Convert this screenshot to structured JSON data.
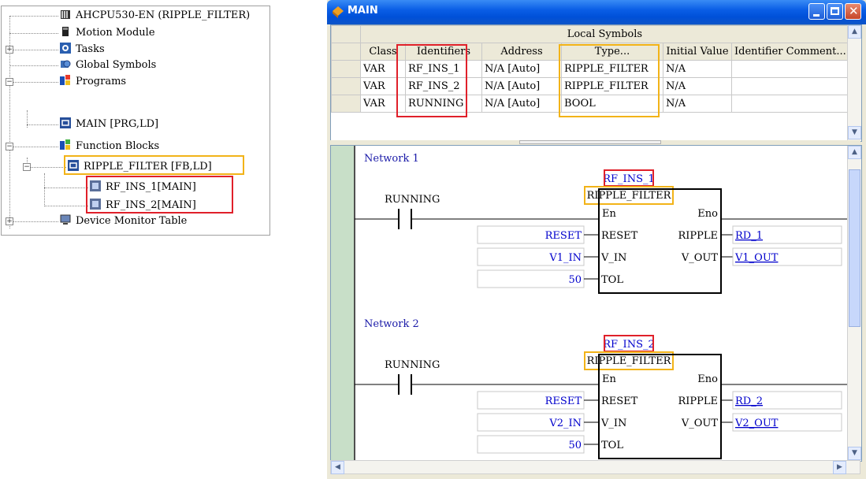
{
  "tree": {
    "items": [
      {
        "label": "AHCPU530-EN  (RIPPLE_FILTER)"
      },
      {
        "label": "Motion Module"
      },
      {
        "label": "Tasks"
      },
      {
        "label": "Global Symbols"
      },
      {
        "label": "Programs"
      },
      {
        "label": "MAIN [PRG,LD]"
      },
      {
        "label": "Function Blocks"
      },
      {
        "label": "RIPPLE_FILTER [FB,LD]"
      },
      {
        "label": "RF_INS_1[MAIN]"
      },
      {
        "label": "RF_INS_2[MAIN]"
      },
      {
        "label": "Device Monitor Table"
      }
    ]
  },
  "window": {
    "title": "MAIN",
    "local_symbols": {
      "caption": "Local Symbols",
      "columns": [
        "Class",
        "Identifiers",
        "Address",
        "Type...",
        "Initial Value",
        "Identifier Comment..."
      ],
      "rows": [
        [
          "VAR",
          "RF_INS_1",
          "N/A [Auto]",
          "RIPPLE_FILTER",
          "N/A",
          ""
        ],
        [
          "VAR",
          "RF_INS_2",
          "N/A [Auto]",
          "RIPPLE_FILTER",
          "N/A",
          ""
        ],
        [
          "VAR",
          "RUNNING",
          "N/A [Auto]",
          "BOOL",
          "N/A",
          ""
        ]
      ]
    }
  },
  "networks": [
    {
      "title": "Network 1",
      "contact": "RUNNING",
      "instance": "RF_INS_1",
      "fb_type": "RIPPLE_FILTER",
      "pin_en": "En",
      "pin_eno": "Eno",
      "inputs": [
        {
          "pin": "RESET",
          "var": "RESET"
        },
        {
          "pin": "V_IN",
          "var": "V1_IN"
        },
        {
          "pin": "TOL",
          "var": "50"
        }
      ],
      "outputs": [
        {
          "pin": "RIPPLE",
          "var": "RD_1"
        },
        {
          "pin": "V_OUT",
          "var": "V1_OUT"
        }
      ]
    },
    {
      "title": "Network 2",
      "contact": "RUNNING",
      "instance": "RF_INS_2",
      "fb_type": "RIPPLE_FILTER",
      "pin_en": "En",
      "pin_eno": "Eno",
      "inputs": [
        {
          "pin": "RESET",
          "var": "RESET"
        },
        {
          "pin": "V_IN",
          "var": "V2_IN"
        },
        {
          "pin": "TOL",
          "var": "50"
        }
      ],
      "outputs": [
        {
          "pin": "RIPPLE",
          "var": "RD_2"
        },
        {
          "pin": "V_OUT",
          "var": "V2_OUT"
        }
      ]
    }
  ],
  "colors": {
    "highlight_red": "#e0202a",
    "highlight_yellow": "#f2b318",
    "ld_var_blue": "#0000cc",
    "rail_green": "#c8dfc8"
  }
}
